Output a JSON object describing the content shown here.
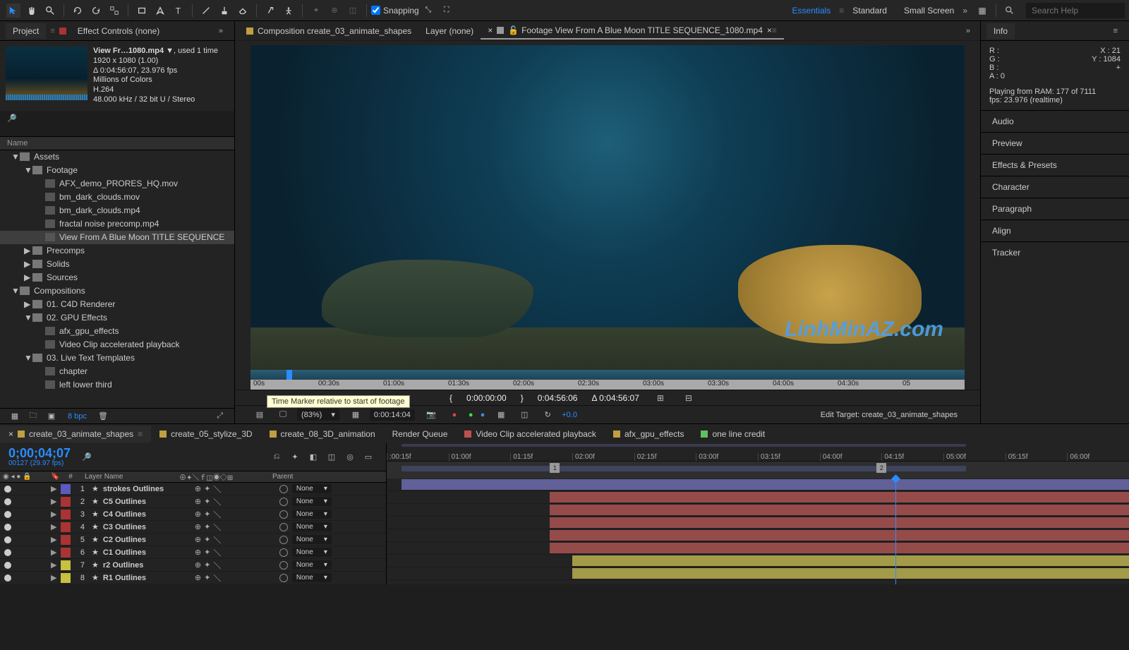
{
  "toolbar": {
    "snapping": "Snapping",
    "workspaces": [
      "Essentials",
      "Standard",
      "Small Screen"
    ],
    "search_placeholder": "Search Help"
  },
  "project": {
    "tab_project": "Project",
    "tab_effect_controls": "Effect Controls (none)",
    "asset_title": "View Fr…1080.mp4 ▼",
    "asset_used": ", used 1 time",
    "asset_dim": "1920 x 1080 (1.00)",
    "asset_dur": "Δ 0:04:56:07, 23.976 fps",
    "asset_colors": "Millions of Colors",
    "asset_codec": "H.264",
    "asset_audio": "48.000 kHz / 32 bit U / Stereo",
    "name_label": "Name",
    "bpc": "8 bpc",
    "tree": [
      {
        "t": 0,
        "lvl": 1,
        "open": true,
        "label": "Assets"
      },
      {
        "t": 0,
        "lvl": 2,
        "open": true,
        "label": "Footage"
      },
      {
        "t": 1,
        "lvl": 3,
        "label": "AFX_demo_PRORES_HQ.mov"
      },
      {
        "t": 1,
        "lvl": 3,
        "label": "bm_dark_clouds.mov"
      },
      {
        "t": 1,
        "lvl": 3,
        "label": "bm_dark_clouds.mp4"
      },
      {
        "t": 1,
        "lvl": 3,
        "label": "fractal noise precomp.mp4"
      },
      {
        "t": 1,
        "lvl": 3,
        "label": "View From A Blue Moon TITLE SEQUENCE",
        "sel": true
      },
      {
        "t": 0,
        "lvl": 2,
        "open": false,
        "label": "Precomps"
      },
      {
        "t": 0,
        "lvl": 2,
        "open": false,
        "label": "Solids"
      },
      {
        "t": 0,
        "lvl": 2,
        "open": false,
        "label": "Sources"
      },
      {
        "t": 0,
        "lvl": 1,
        "open": true,
        "label": "Compositions"
      },
      {
        "t": 0,
        "lvl": 2,
        "open": false,
        "label": "01. C4D Renderer"
      },
      {
        "t": 0,
        "lvl": 2,
        "open": true,
        "label": "02. GPU Effects"
      },
      {
        "t": 2,
        "lvl": 3,
        "label": "afx_gpu_effects"
      },
      {
        "t": 2,
        "lvl": 3,
        "label": "Video Clip accelerated playback"
      },
      {
        "t": 0,
        "lvl": 2,
        "open": true,
        "label": "03. Live Text Templates"
      },
      {
        "t": 2,
        "lvl": 3,
        "label": "chapter"
      },
      {
        "t": 2,
        "lvl": 3,
        "label": "left lower third"
      }
    ]
  },
  "viewer": {
    "tabs": [
      {
        "label": "Composition create_03_animate_shapes",
        "color": "#c0a040"
      },
      {
        "label": "Layer (none)",
        "color": null
      },
      {
        "label": "Footage View From A Blue Moon TITLE SEQUENCE_1080.mp4",
        "color": "#999",
        "active": true,
        "close": true
      }
    ],
    "mini_labels": [
      "00s",
      "00:30s",
      "01:00s",
      "01:30s",
      "02:00s",
      "02:30s",
      "03:00s",
      "03:30s",
      "04:00s",
      "04:30s",
      "05"
    ],
    "in": "0:00:00:00",
    "out": "0:04:56:06",
    "dur": "Δ 0:04:56:07",
    "mag": "(83%)",
    "tc": "0:00:14:04",
    "exp": "+0.0",
    "edit_target": "Edit Target: create_03_animate_shapes",
    "tooltip": "Time Marker relative to start of footage",
    "watermark": "LinhMinAZ.com"
  },
  "info": {
    "title": "Info",
    "r": "R :",
    "g": "G :",
    "b": "B :",
    "a": "A :",
    "a_val": "0",
    "x": "X : 21",
    "y": "Y : 1084",
    "ram": "Playing from RAM: 177 of 7111",
    "fps": "fps: 23.976 (realtime)",
    "sections": [
      "Audio",
      "Preview",
      "Effects & Presets",
      "Character",
      "Paragraph",
      "Align",
      "Tracker"
    ]
  },
  "timeline": {
    "tabs": [
      {
        "label": "create_03_animate_shapes",
        "color": "#c0a040",
        "active": true,
        "close": true
      },
      {
        "label": "create_05_stylize_3D",
        "color": "#c0a040"
      },
      {
        "label": "create_08_3D_animation",
        "color": "#c0a040"
      },
      {
        "label": "Render Queue",
        "color": null
      },
      {
        "label": "Video Clip accelerated playback",
        "color": "#c05050"
      },
      {
        "label": "afx_gpu_effects",
        "color": "#c0a040"
      },
      {
        "label": "one line credit",
        "color": "#5fc060"
      }
    ],
    "timecode": "0;00;04;07",
    "timecode_sub": "00127 (29.97 fps)",
    "col_num": "#",
    "col_name": "Layer Name",
    "col_parent": "Parent",
    "parent_none": "None",
    "ruler": [
      ":00:15f",
      "01:00f",
      "01:15f",
      "02:00f",
      "02:15f",
      "03:00f",
      "03:15f",
      "04:00f",
      "04:15f",
      "05:00f",
      "05:15f",
      "06:00f"
    ],
    "wa_m1": "1",
    "wa_m2": "2",
    "layers": [
      {
        "n": 1,
        "name": "strokes Outlines",
        "color": "#5a5ac0",
        "bar_c": "#6967a5",
        "s": 2,
        "e": 100
      },
      {
        "n": 2,
        "name": "C5 Outlines",
        "color": "#a33",
        "bar_c": "#a35050",
        "s": 22,
        "e": 100
      },
      {
        "n": 3,
        "name": "C4 Outlines",
        "color": "#a33",
        "bar_c": "#a35050",
        "s": 22,
        "e": 100
      },
      {
        "n": 4,
        "name": "C3 Outlines",
        "color": "#a33",
        "bar_c": "#a35050",
        "s": 22,
        "e": 100
      },
      {
        "n": 5,
        "name": "C2 Outlines",
        "color": "#a33",
        "bar_c": "#a35050",
        "s": 22,
        "e": 100
      },
      {
        "n": 6,
        "name": "C1 Outlines",
        "color": "#a33",
        "bar_c": "#a35050",
        "s": 22,
        "e": 100
      },
      {
        "n": 7,
        "name": "r2 Outlines",
        "color": "#c8c040",
        "bar_c": "#b2a84c",
        "s": 25,
        "e": 100
      },
      {
        "n": 8,
        "name": "R1 Outlines",
        "color": "#c8c040",
        "bar_c": "#b2a84c",
        "s": 25,
        "e": 100
      }
    ]
  }
}
